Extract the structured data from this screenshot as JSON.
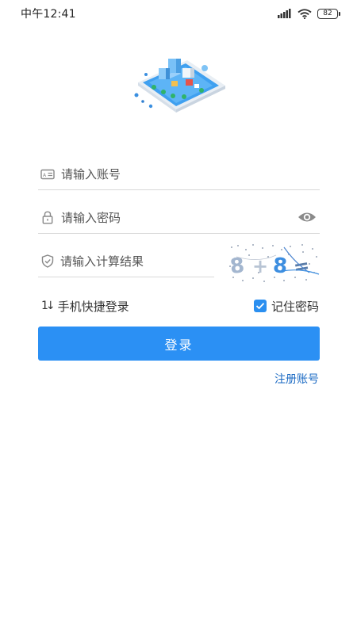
{
  "status_bar": {
    "time": "中午12:41",
    "battery": "82",
    "icons": [
      "signal-icon",
      "wifi-icon",
      "battery-icon"
    ]
  },
  "illustration": {
    "icon": "smart-city-illustration"
  },
  "form": {
    "account": {
      "placeholder": "请输入账号",
      "value": "",
      "icon": "id-card-icon"
    },
    "password": {
      "placeholder": "请输入密码",
      "value": "",
      "icon": "lock-icon",
      "toggle_icon": "eye-icon"
    },
    "captcha": {
      "placeholder": "请输入计算结果",
      "value": "",
      "icon": "shield-icon",
      "image_text": "8 + 8 ="
    }
  },
  "options": {
    "quick_login_icon": "1↓",
    "quick_login_label": "手机快捷登录",
    "remember_label": "记住密码",
    "remember_checked": true
  },
  "login_button": "登录",
  "register_link": "注册账号",
  "colors": {
    "primary": "#2b90f4",
    "link": "#1e6cc4",
    "divider": "#d8d8d8"
  }
}
